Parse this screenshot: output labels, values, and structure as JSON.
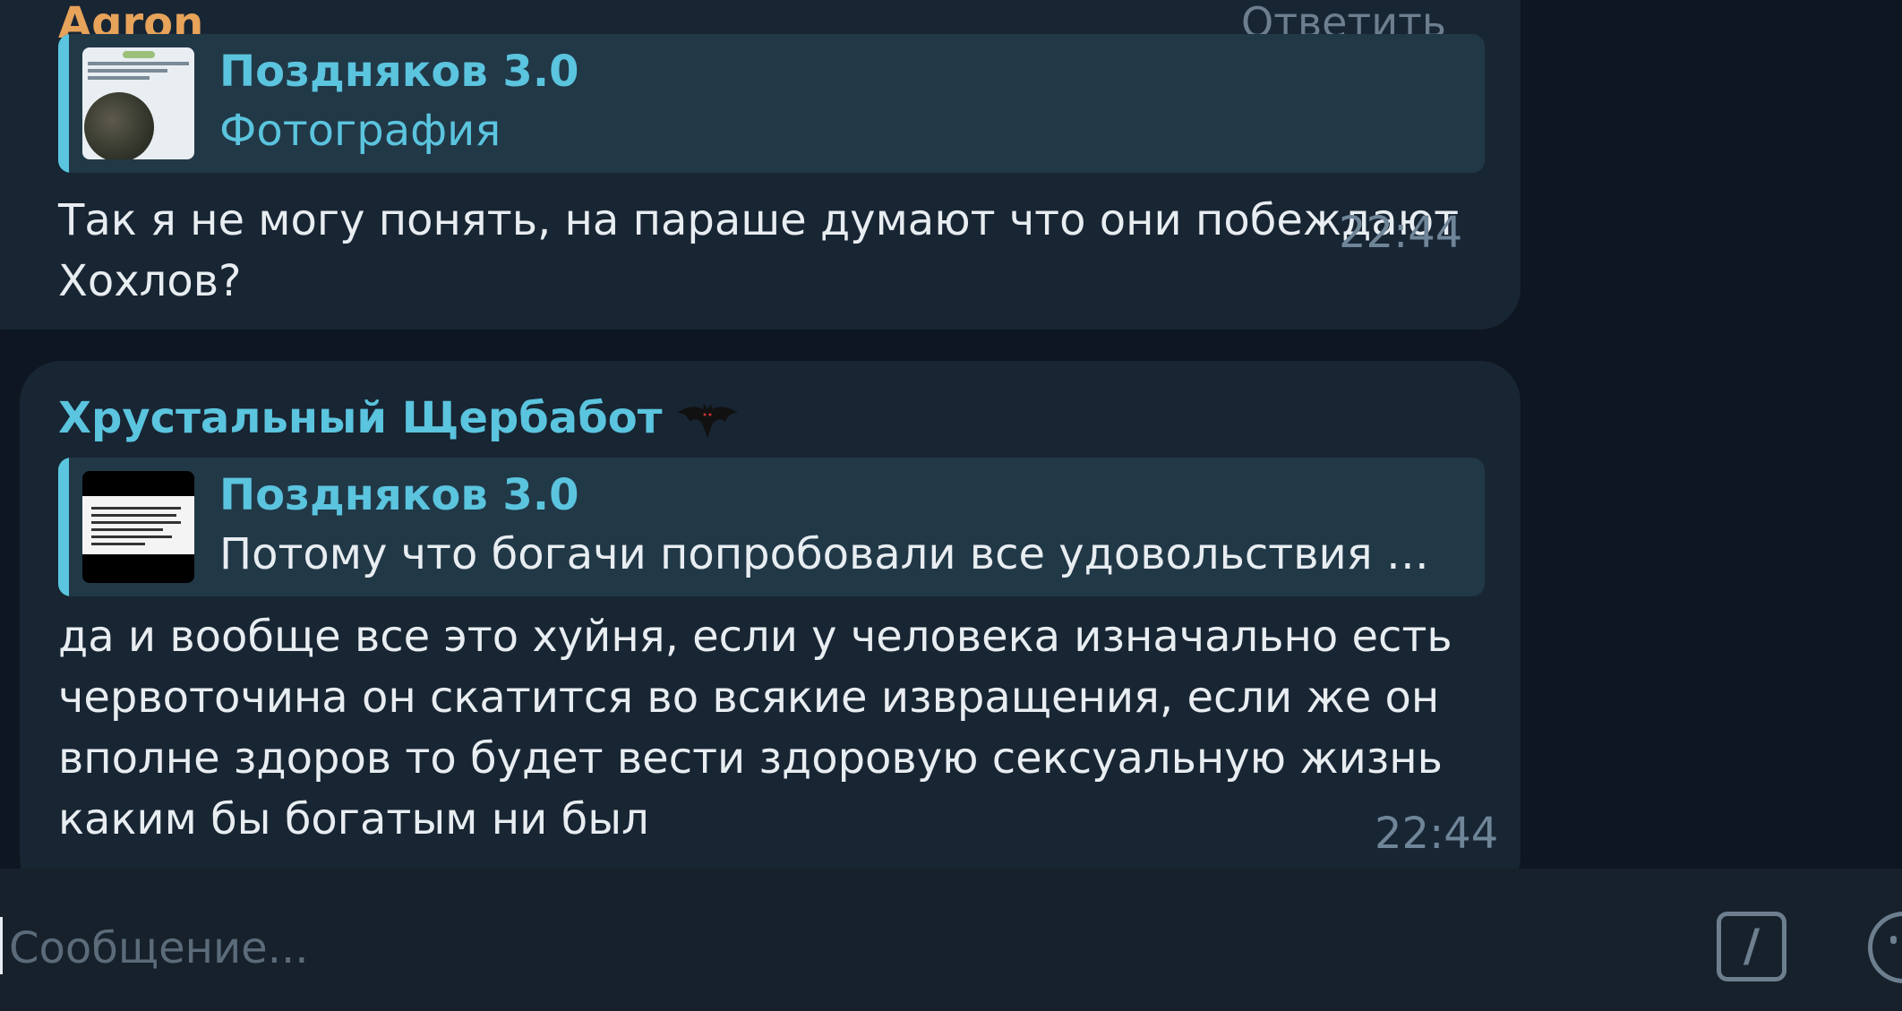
{
  "messages": [
    {
      "sender": "Agron",
      "sender_color": "#e7a35a",
      "reply_action": "Ответить",
      "reply": {
        "author": "Поздняков 3.0",
        "text": "Фотография",
        "thumbnail": "photo-thumbnail"
      },
      "text": "Так я не могу понять, на параше думают что они побеждают Хохлов?",
      "time": "22:44"
    },
    {
      "sender": "Хрустальный Щербабот",
      "sender_color": "#5bc4de",
      "sender_badge": "bat-icon",
      "reply": {
        "author": "Поздняков 3.0",
        "text": "Потому что богачи попробовали все удовольствия ж...",
        "thumbnail": "document-thumbnail"
      },
      "text": "да и вообще все это хуйня, если у человека изначально есть червоточина он скатится во всякие извращения, если же он вполне здоров то будет вести здоровую сексуальную жизнь каким бы богатым ни был",
      "time": "22:44"
    }
  ],
  "composer": {
    "placeholder": "Сообщение...",
    "command_button": "/",
    "emoji_icon": "smile-icon"
  },
  "colors": {
    "background": "#0e1621",
    "bubble": "#182533",
    "quote_bg": "#213847",
    "accent": "#5bc4de",
    "time": "#6f8598"
  }
}
